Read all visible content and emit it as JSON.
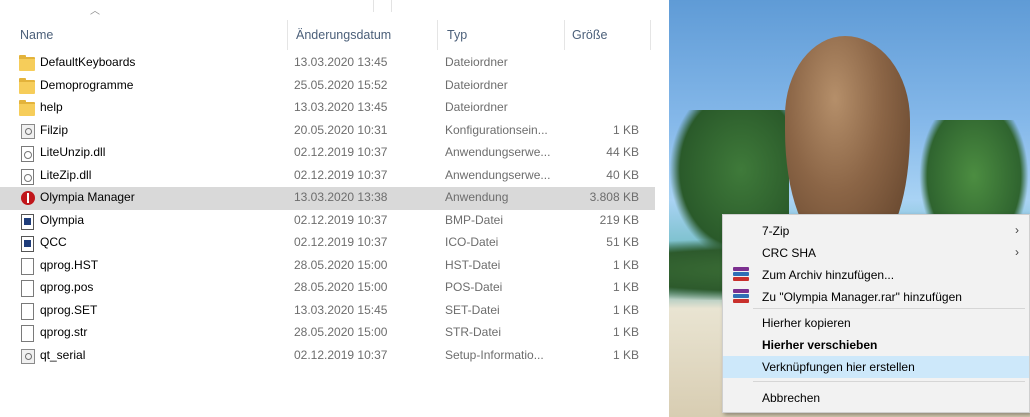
{
  "columns": {
    "name": "Name",
    "date": "Änderungsdatum",
    "type": "Typ",
    "size": "Größe"
  },
  "files": [
    {
      "name": "DefaultKeyboards",
      "date": "13.03.2020 13:45",
      "type": "Dateiordner",
      "size": "",
      "icon": "folder-icon"
    },
    {
      "name": "Demoprogramme",
      "date": "25.05.2020 15:52",
      "type": "Dateiordner",
      "size": "",
      "icon": "folder-icon"
    },
    {
      "name": "help",
      "date": "13.03.2020 13:45",
      "type": "Dateiordner",
      "size": "",
      "icon": "folder-icon"
    },
    {
      "name": "Filzip",
      "date": "20.05.2020 10:31",
      "type": "Konfigurationsein...",
      "size": "1 KB",
      "icon": "config-file-icon"
    },
    {
      "name": "LiteUnzip.dll",
      "date": "02.12.2019 10:37",
      "type": "Anwendungserwe...",
      "size": "44 KB",
      "icon": "dll-file-icon"
    },
    {
      "name": "LiteZip.dll",
      "date": "02.12.2019 10:37",
      "type": "Anwendungserwe...",
      "size": "40 KB",
      "icon": "dll-file-icon"
    },
    {
      "name": "Olympia Manager",
      "date": "13.03.2020 13:38",
      "type": "Anwendung",
      "size": "3.808 KB",
      "icon": "olympia-app-icon",
      "selected": true
    },
    {
      "name": "Olympia",
      "date": "02.12.2019 10:37",
      "type": "BMP-Datei",
      "size": "219 KB",
      "icon": "bmp-file-icon"
    },
    {
      "name": "QCC",
      "date": "02.12.2019 10:37",
      "type": "ICO-Datei",
      "size": "51 KB",
      "icon": "ico-file-icon"
    },
    {
      "name": "qprog.HST",
      "date": "28.05.2020 15:00",
      "type": "HST-Datei",
      "size": "1 KB",
      "icon": "document-icon"
    },
    {
      "name": "qprog.pos",
      "date": "28.05.2020 15:00",
      "type": "POS-Datei",
      "size": "1 KB",
      "icon": "document-icon"
    },
    {
      "name": "qprog.SET",
      "date": "13.03.2020 15:45",
      "type": "SET-Datei",
      "size": "1 KB",
      "icon": "document-icon"
    },
    {
      "name": "qprog.str",
      "date": "28.05.2020 15:00",
      "type": "STR-Datei",
      "size": "1 KB",
      "icon": "document-icon"
    },
    {
      "name": "qt_serial",
      "date": "02.12.2019 10:37",
      "type": "Setup-Informatio...",
      "size": "1 KB",
      "icon": "config-file-icon"
    }
  ],
  "context_menu": {
    "items": [
      {
        "label": "7-Zip",
        "submenu": true
      },
      {
        "label": "CRC SHA",
        "submenu": true
      },
      {
        "label": "Zum Archiv hinzufügen...",
        "icon": "winrar-icon"
      },
      {
        "label": "Zu \"Olympia Manager.rar\" hinzufügen",
        "icon": "winrar-icon"
      },
      {
        "label": "Hierher kopieren"
      },
      {
        "label": "Hierher verschieben",
        "bold": true
      },
      {
        "label": "Verknüpfungen hier erstellen",
        "highlighted": true
      },
      {
        "label": "Abbrechen"
      }
    ]
  },
  "colors": {
    "selected_row": "#d9d9d9",
    "menu_highlight": "#cde8fa",
    "olympia_red": "#c0161b"
  }
}
